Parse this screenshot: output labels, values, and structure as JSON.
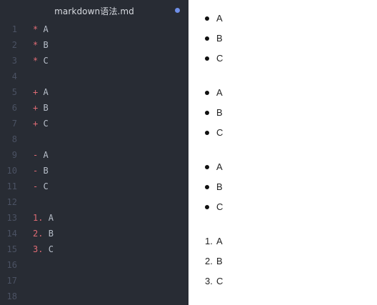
{
  "editor": {
    "tab_title": "markdown语法.md",
    "modified_indicator_color": "#6f8fe8",
    "line_numbers": [
      "1",
      "2",
      "3",
      "4",
      "5",
      "6",
      "7",
      "8",
      "9",
      "10",
      "11",
      "12",
      "13",
      "14",
      "15",
      "16",
      "17",
      "18"
    ],
    "lines": [
      {
        "marker": "*",
        "text": "A"
      },
      {
        "marker": "*",
        "text": "B"
      },
      {
        "marker": "*",
        "text": "C"
      },
      {
        "marker": "",
        "text": ""
      },
      {
        "marker": "+",
        "text": "A"
      },
      {
        "marker": "+",
        "text": "B"
      },
      {
        "marker": "+",
        "text": "C"
      },
      {
        "marker": "",
        "text": ""
      },
      {
        "marker": "-",
        "text": "A"
      },
      {
        "marker": "-",
        "text": "B"
      },
      {
        "marker": "-",
        "text": "C"
      },
      {
        "marker": "",
        "text": ""
      },
      {
        "marker": "1.",
        "text": "A"
      },
      {
        "marker": "2.",
        "text": "B"
      },
      {
        "marker": "3.",
        "text": "C"
      },
      {
        "marker": "",
        "text": ""
      },
      {
        "marker": "",
        "text": ""
      },
      {
        "marker": "",
        "text": ""
      }
    ]
  },
  "preview": {
    "lists": [
      {
        "type": "unordered",
        "items": [
          "A",
          "B",
          "C"
        ]
      },
      {
        "type": "unordered",
        "items": [
          "A",
          "B",
          "C"
        ]
      },
      {
        "type": "unordered",
        "items": [
          "A",
          "B",
          "C"
        ]
      },
      {
        "type": "ordered",
        "markers": [
          "1.",
          "2.",
          "3."
        ],
        "items": [
          "A",
          "B",
          "C"
        ]
      }
    ]
  },
  "colors": {
    "editor_bg": "#282c34",
    "line_number": "#4b5263",
    "marker": "#e06c75",
    "code_text": "#b7bec9"
  }
}
